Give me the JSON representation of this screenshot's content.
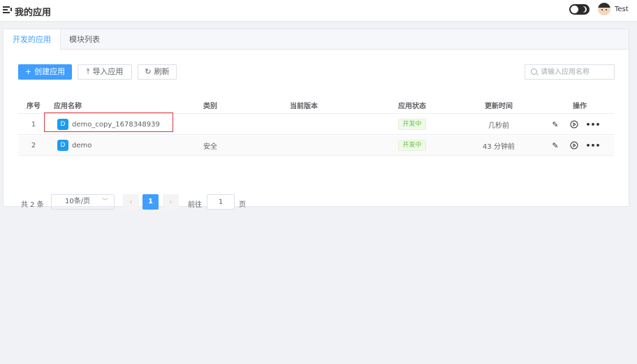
{
  "header": {
    "title": "我的应用",
    "username": "Test"
  },
  "tabs": [
    {
      "label": "开发的应用",
      "active": true
    },
    {
      "label": "模块列表",
      "active": false
    }
  ],
  "toolbar": {
    "create_label": "创建应用",
    "import_label": "导入应用",
    "refresh_label": "刷新",
    "search_placeholder": "请输入应用名称"
  },
  "table": {
    "columns": [
      "序号",
      "应用名称",
      "类别",
      "当前版本",
      "应用状态",
      "更新时间",
      "操作"
    ],
    "rows": [
      {
        "index": "1",
        "icon_letter": "D",
        "name": "demo_copy_1678348939",
        "category": "",
        "version": "",
        "status": "开发中",
        "updated": "几秒前"
      },
      {
        "index": "2",
        "icon_letter": "D",
        "name": "demo",
        "category": "安全",
        "version": "",
        "status": "开发中",
        "updated": "43 分钟前"
      }
    ]
  },
  "pagination": {
    "total_label": "共 2 条",
    "page_size_label": "10条/页",
    "current_page": "1",
    "goto_label": "前往",
    "goto_value": "1",
    "page_unit": "页"
  },
  "colors": {
    "primary": "#409eff",
    "status_green": "#67c23a",
    "highlight_red": "#d9363e",
    "app_icon": "#1d9bf0"
  }
}
